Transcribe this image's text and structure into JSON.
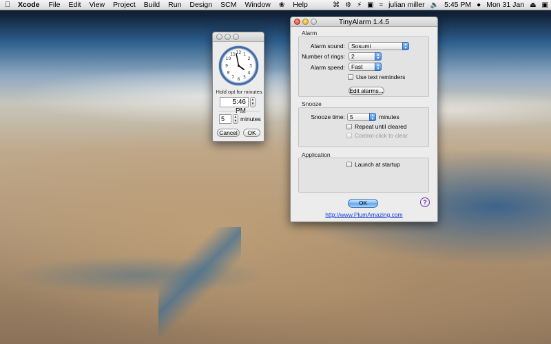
{
  "menubar": {
    "app_name": "Xcode",
    "items": [
      "File",
      "Edit",
      "View",
      "Project",
      "Build",
      "Run",
      "Design",
      "SCM",
      "Window",
      "Help"
    ],
    "user": "julian miller",
    "time": "5:45 PM",
    "date": "Mon 31 Jan"
  },
  "clock_window": {
    "hold_label": "Hold opt for minutes",
    "time_value": "5:46 PM",
    "minutes_value": "5",
    "minutes_label": "minutes",
    "cancel_label": "Cancel",
    "ok_label": "OK"
  },
  "alarm_window": {
    "title": "TinyAlarm 1.4.5",
    "alarm": {
      "group_label": "Alarm",
      "sound_label": "Alarm sound:",
      "sound_value": "Sosumi",
      "rings_label": "Number of rings:",
      "rings_value": "2",
      "speed_label": "Alarm speed:",
      "speed_value": "Fast",
      "text_reminders_label": "Use text reminders",
      "edit_alarms_label": "Edit alarms..."
    },
    "snooze": {
      "group_label": "Snooze",
      "time_label": "Snooze time:",
      "time_value": "5",
      "minutes_label": "minutes",
      "repeat_label": "Repeat until cleared",
      "control_click_label": "Control-click to clear"
    },
    "application": {
      "group_label": "Application",
      "launch_label": "Launch at startup"
    },
    "ok_label": "OK",
    "help_label": "?",
    "link": "http://www.PlumAmazing.com"
  },
  "colors": {
    "default_button": "#5aa4ec",
    "link": "#1a3fd6",
    "clock_rim": "#3d6fb5"
  }
}
